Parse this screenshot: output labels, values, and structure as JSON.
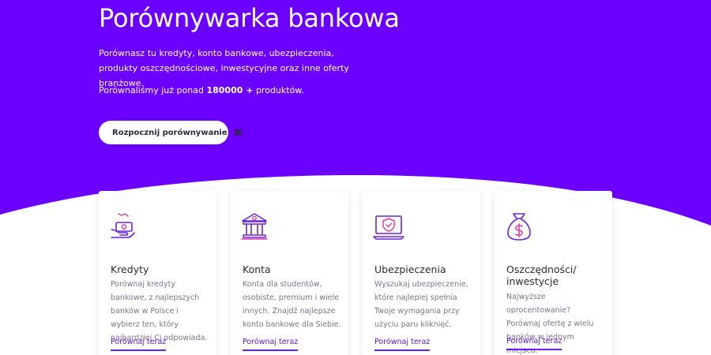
{
  "hero": {
    "title": "Porównywarka bankowa",
    "description": "Porównasz tu kredyty, konto bankowe, ubezpieczenia, produkty oszczędnościowe, inwestycyjne oraz inne oferty branżowe.",
    "stat_prefix": "Porównaliśmy już ponad ",
    "stat_value": "180000 +",
    "stat_suffix": " produktów.",
    "cta_label": "Rozpocznij porównywanie",
    "cta_icon": "collapse-arrows-icon"
  },
  "colors": {
    "brand_purple": "#6c00ff",
    "text_dark": "#2b2b3a",
    "text_muted": "#777787",
    "icon_purple": "#6a24d8",
    "icon_pink": "#e23ea6"
  },
  "cards": [
    {
      "icon": "hand-money-icon",
      "title": "Kredyty",
      "description": "Porównaj kredyty bankowe, z najlepszych banków w Polsce i wybierz ten, który najbardziej Ci odpowiada.",
      "link": "Porównaj teraz"
    },
    {
      "icon": "bank-icon",
      "title": "Konta",
      "description": "Konta dla studentów, osobiste, premium i wiele innych. Znajdź najlepsze konto bankowe dla Siebie.",
      "link": "Porównaj teraz"
    },
    {
      "icon": "laptop-shield-icon",
      "title": "Ubezpieczenia",
      "description": "Wyszukaj ubezpieczenie, które najlepiej spełnia Twoje wymagania przy użyciu paru kliknięć.",
      "link": "Porównaj teraz"
    },
    {
      "icon": "money-bag-icon",
      "title": "Oszczędności/ inwestycje",
      "description": "Najwyższe oprocentowanie? Porównaj ofertę z wielu banków w jednym miejscu.",
      "link": "Porównaj teraz"
    }
  ]
}
